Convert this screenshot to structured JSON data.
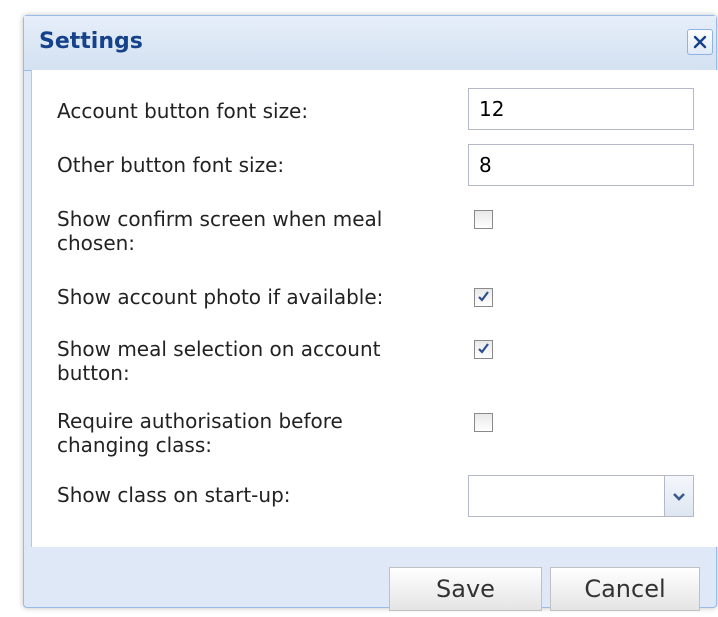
{
  "dialog": {
    "title": "Settings",
    "close_icon": "close-icon"
  },
  "fields": {
    "account_font_label": "Account button font size:",
    "account_font_value": "12",
    "other_font_label": "Other button font size:",
    "other_font_value": "8",
    "confirm_meal_label": "Show confirm screen when meal chosen:",
    "confirm_meal_checked": false,
    "account_photo_label": "Show account photo if available:",
    "account_photo_checked": true,
    "meal_selection_label": "Show meal selection on account button:",
    "meal_selection_checked": true,
    "require_auth_label": "Require authorisation before changing class:",
    "require_auth_checked": false,
    "class_startup_label": "Show class on start-up:",
    "class_startup_value": ""
  },
  "footer": {
    "save_label": "Save",
    "cancel_label": "Cancel"
  },
  "colors": {
    "title": "#15428b",
    "frame": "#99bbe8",
    "footer_bg": "#dfe8f6"
  }
}
